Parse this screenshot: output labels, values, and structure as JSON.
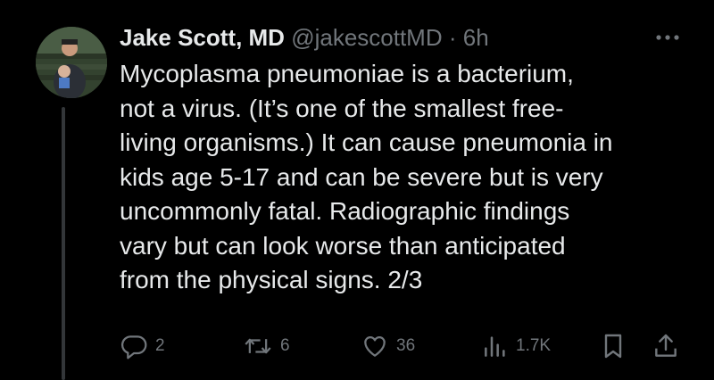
{
  "author": {
    "name": "Jake Scott, MD",
    "handle": "@jakescottMD",
    "separator": "·",
    "time": "6h"
  },
  "tweet": {
    "lines": [
      "Mycoplasma pneumoniae is a bacterium,",
      "not a virus. (It’s one of the smallest free-",
      "living organisms.) It can cause pneumonia in",
      "kids age 5-17 and can be severe but is very",
      "uncommonly fatal. Radiographic findings",
      "vary but can look worse than anticipated",
      "from the physical signs. 2/3"
    ]
  },
  "actions": {
    "reply_count": "2",
    "retweet_count": "6",
    "like_count": "36",
    "view_count": "1.7K"
  },
  "icons": {
    "reply": "reply-icon",
    "retweet": "retweet-icon",
    "like": "heart-icon",
    "views": "views-icon",
    "bookmark": "bookmark-icon",
    "share": "share-icon",
    "more": "more-icon"
  },
  "colors": {
    "background": "#000000",
    "text": "#e7e9ea",
    "muted": "#71767b",
    "thread_line": "#333639"
  }
}
